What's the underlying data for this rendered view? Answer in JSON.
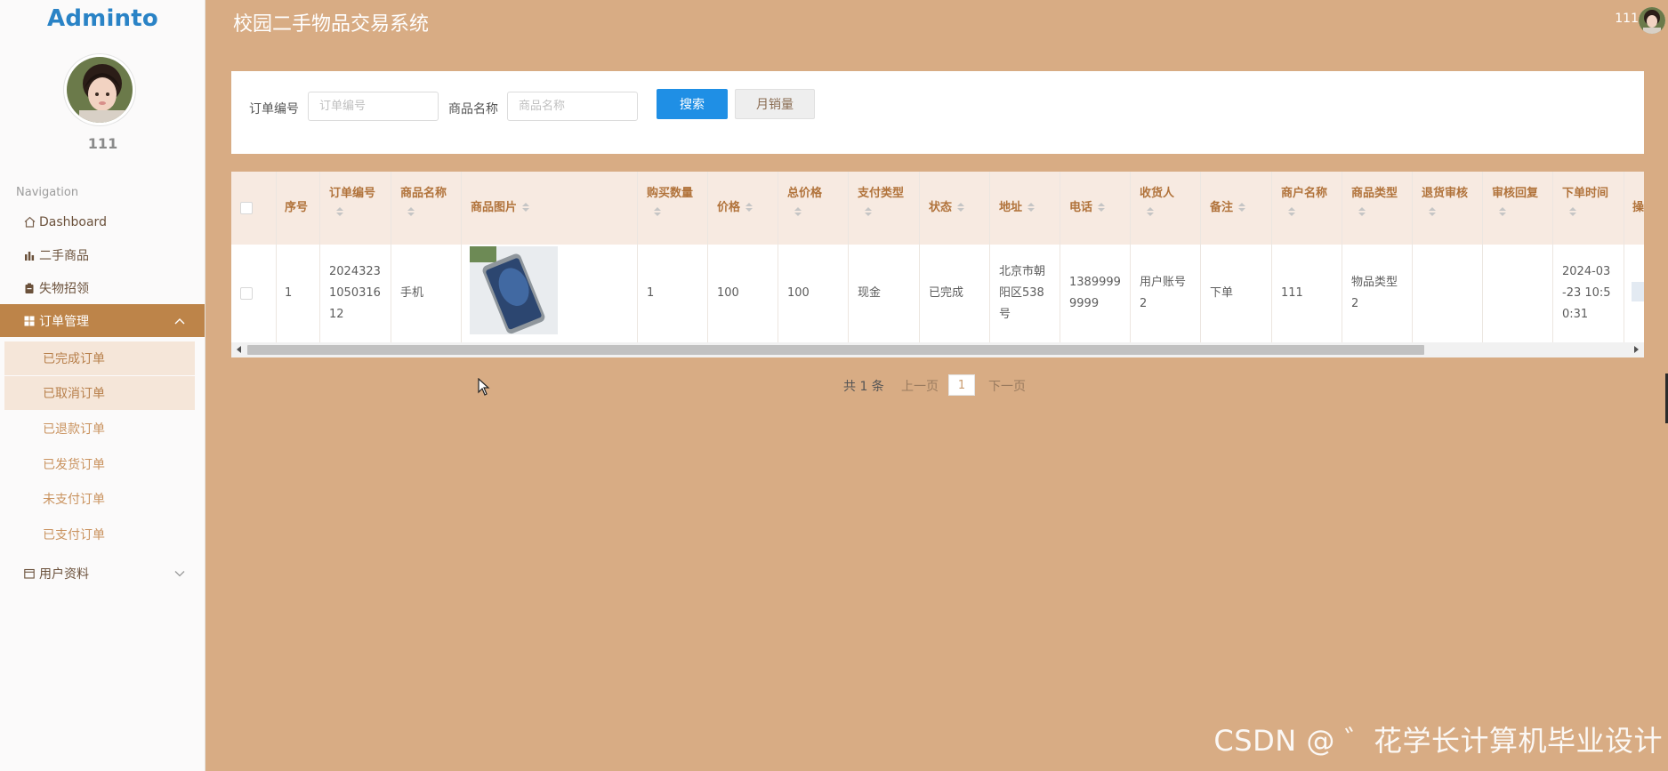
{
  "sidebar": {
    "logo": "Adminto",
    "username": "111",
    "nav_heading": "Navigation",
    "items": [
      {
        "label": "Dashboard",
        "icon": "home-icon"
      },
      {
        "label": "二手商品",
        "icon": "bar-chart-icon"
      },
      {
        "label": "失物招领",
        "icon": "clipboard-icon"
      },
      {
        "label": "订单管理",
        "icon": "grid-icon",
        "expanded": true
      },
      {
        "label": "用户资料",
        "icon": "calendar-icon",
        "expanded": false
      }
    ],
    "subitems": [
      "已完成订单",
      "已取消订单",
      "已退款订单",
      "已发货订单",
      "未支付订单",
      "已支付订单"
    ]
  },
  "header": {
    "title": "校园二手物品交易系统",
    "user": "111"
  },
  "search": {
    "order_no_label": "订单编号",
    "order_no_placeholder": "订单编号",
    "product_label": "商品名称",
    "product_placeholder": "商品名称",
    "search_button": "搜索",
    "monthly_button": "月销量"
  },
  "table": {
    "columns": [
      "序号",
      "订单编号",
      "商品名称",
      "商品图片",
      "购买数量",
      "价格",
      "总价格",
      "支付类型",
      "状态",
      "地址",
      "电话",
      "收货人",
      "备注",
      "商户名称",
      "商品类型",
      "退货审核",
      "审核回复",
      "下单时间",
      "操"
    ],
    "rows": [
      {
        "index": "1",
        "order_no": [
          "2024323",
          "1050316",
          "12"
        ],
        "product_name": "手机",
        "quantity": "1",
        "price": "100",
        "total": "100",
        "pay_type": "现金",
        "status": "已完成",
        "address": [
          "北京市朝",
          "阳区538",
          "号"
        ],
        "phone": [
          "1389999",
          "9999"
        ],
        "receiver": [
          "用户账号",
          "2"
        ],
        "remark": "下单",
        "merchant": "111",
        "product_type": [
          "物品类型",
          "2"
        ],
        "return_review": "",
        "review_reply": "",
        "order_time": [
          "2024-03",
          "-23 10:5",
          "0:31"
        ]
      }
    ]
  },
  "pagination": {
    "total": "共 1 条",
    "prev": "上一页",
    "current": "1",
    "next": "下一页"
  },
  "watermark": "CSDN @ ゛花学长计算机毕业设计",
  "colors": {
    "background": "#d8ac84",
    "sidebar_active": "#bd8449",
    "primary_button": "#1f8fe5",
    "header_row": "#f7eae1",
    "header_text": "#b1733b"
  }
}
